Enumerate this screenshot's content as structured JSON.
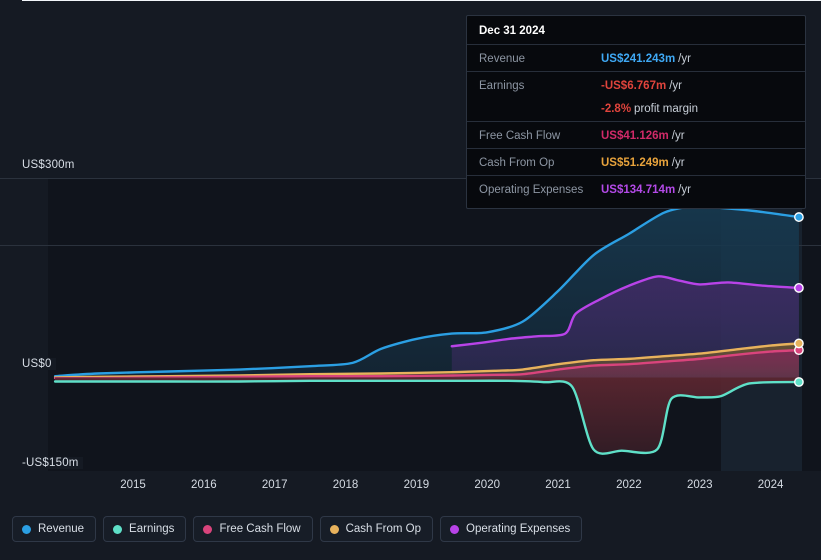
{
  "chart_data": {
    "type": "area",
    "title": "",
    "xlabel": "",
    "ylabel": "",
    "grid": true,
    "legend_position": "bottom-left",
    "xlim": [
      2014.3,
      2025.0
    ],
    "ylim": [
      -150,
      300
    ],
    "y_ticks": [
      {
        "value": 300,
        "label": "US$300m"
      },
      {
        "value": 0,
        "label": "US$0"
      },
      {
        "value": -150,
        "label": "-US$150m"
      }
    ],
    "x_ticks": [
      "2015",
      "2016",
      "2017",
      "2018",
      "2019",
      "2020",
      "2021",
      "2022",
      "2023",
      "2024"
    ],
    "highlight_band": {
      "from": 2023.8,
      "to": 2024.95
    },
    "units": "US$ millions per year",
    "series": [
      {
        "name": "Revenue",
        "color": "#2b9fe3",
        "fill": "#17384e",
        "x": [
          2014.4,
          2015.0,
          2016.0,
          2017.0,
          2018.0,
          2018.6,
          2019.0,
          2019.5,
          2020.0,
          2020.5,
          2021.0,
          2021.5,
          2022.0,
          2022.5,
          2023.0,
          2023.4,
          2023.8,
          2024.3,
          2024.9
        ],
        "values": [
          2,
          6,
          9,
          12,
          17,
          22,
          43,
          58,
          66,
          68,
          84,
          130,
          184,
          216,
          248,
          257,
          255,
          250,
          241.243
        ]
      },
      {
        "name": "Earnings",
        "color": "#5fe0c8",
        "fill": "#5a2630",
        "x": [
          2014.4,
          2015.0,
          2016.0,
          2017.0,
          2018.0,
          2019.0,
          2020.0,
          2020.8,
          2021.3,
          2021.7,
          2022.0,
          2022.4,
          2022.9,
          2023.1,
          2023.5,
          2023.8,
          2024.2,
          2024.9
        ],
        "values": [
          -6,
          -6,
          -6,
          -6,
          -5,
          -5,
          -5,
          -5,
          -7,
          -14,
          -108,
          -110,
          -108,
          -32,
          -30,
          -28,
          -9,
          -6.767
        ]
      },
      {
        "name": "Free Cash Flow",
        "color": "#d9447c",
        "fill": "#7a2a55",
        "x": [
          2014.4,
          2015.0,
          2016.0,
          2017.0,
          2018.0,
          2019.0,
          2020.0,
          2020.6,
          2021.0,
          2021.5,
          2022.0,
          2022.5,
          2023.0,
          2023.5,
          2024.0,
          2024.5,
          2024.9
        ],
        "values": [
          -1,
          -1,
          0,
          1,
          2,
          2,
          3,
          4,
          5,
          12,
          18,
          20,
          24,
          28,
          34,
          39,
          41.126
        ]
      },
      {
        "name": "Cash From Op",
        "color": "#e8b25c",
        "fill": "#6b5330",
        "x": [
          2014.4,
          2015.0,
          2016.0,
          2017.0,
          2018.0,
          2019.0,
          2020.0,
          2020.6,
          2021.0,
          2021.5,
          2022.0,
          2022.5,
          2023.0,
          2023.5,
          2024.0,
          2024.5,
          2024.9
        ],
        "values": [
          0,
          1,
          2,
          3,
          5,
          6,
          8,
          10,
          12,
          20,
          26,
          28,
          32,
          36,
          42,
          48,
          51.249
        ]
      },
      {
        "name": "Operating Expenses",
        "color": "#b843e8",
        "fill": "#3e2b63",
        "x": [
          2020.0,
          2020.4,
          2020.8,
          2021.2,
          2021.6,
          2021.75,
          2022.1,
          2022.5,
          2022.9,
          2023.2,
          2023.5,
          2023.9,
          2024.4,
          2024.9
        ],
        "values": [
          47,
          52,
          58,
          62,
          66,
          96,
          118,
          138,
          152,
          146,
          140,
          143,
          138,
          134.714
        ]
      }
    ]
  },
  "tooltip": {
    "title": "Dec 31 2024",
    "unit_suffix": "/yr",
    "rows": [
      {
        "key": "Revenue",
        "value": "US$241.243m",
        "unit": "/yr",
        "color": "#3fa9f5"
      },
      {
        "key": "Earnings",
        "value": "-US$6.767m",
        "unit": "/yr",
        "color": "#e0443c"
      },
      {
        "key": "",
        "value": "-2.8%",
        "unit": "profit margin",
        "color": "#e0443c"
      },
      {
        "key": "Free Cash Flow",
        "value": "US$41.126m",
        "unit": "/yr",
        "color": "#d12a68"
      },
      {
        "key": "Cash From Op",
        "value": "US$51.249m",
        "unit": "/yr",
        "color": "#e8a33c"
      },
      {
        "key": "Operating Expenses",
        "value": "US$134.714m",
        "unit": "/yr",
        "color": "#b44ae8"
      }
    ]
  },
  "legend": {
    "items": [
      {
        "label": "Revenue",
        "color": "#2b9fe3"
      },
      {
        "label": "Earnings",
        "color": "#5fe0c8"
      },
      {
        "label": "Free Cash Flow",
        "color": "#d9447c"
      },
      {
        "label": "Cash From Op",
        "color": "#e8b25c"
      },
      {
        "label": "Operating Expenses",
        "color": "#b843e8"
      }
    ]
  },
  "axis": {
    "y_top_label": "US$300m",
    "y_zero_label": "US$0",
    "y_bottom_label": "-US$150m"
  }
}
